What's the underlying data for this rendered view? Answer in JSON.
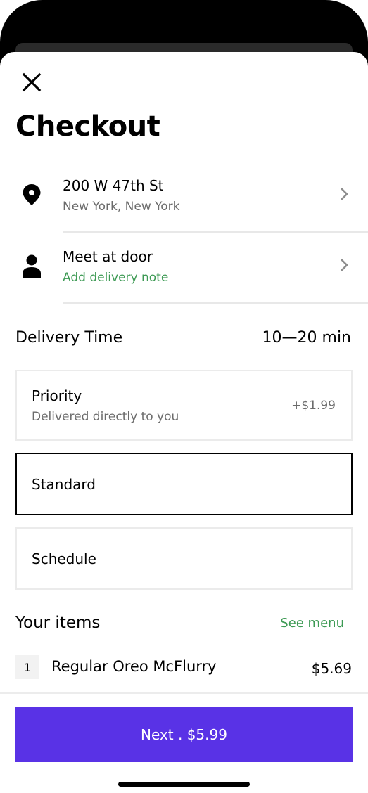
{
  "header": {
    "title": "Checkout"
  },
  "address": {
    "line1": "200 W 47th St",
    "line2": "New York, New York"
  },
  "dropoff": {
    "line1": "Meet at door",
    "line2": "Add delivery note"
  },
  "delivery": {
    "label": "Delivery Time",
    "eta": "10—20 min",
    "options": [
      {
        "name": "Priority",
        "subtitle": "Delivered directly to you",
        "price": "+$1.99",
        "selected": false
      },
      {
        "name": "Standard",
        "selected": true
      },
      {
        "name": "Schedule",
        "selected": false
      }
    ]
  },
  "items": {
    "label": "Your items",
    "see_menu": "See menu",
    "list": [
      {
        "qty": "1",
        "name": "Regular Oreo McFlurry",
        "price": "$5.69"
      }
    ]
  },
  "cta": {
    "label": "Next . $5.99"
  },
  "colors": {
    "accent": "#5932e6",
    "link_green": "#3d9a54",
    "secondary_text": "#6b6b6b"
  },
  "icons": {
    "close": "close-icon",
    "location": "location-pin-icon",
    "person": "person-icon",
    "chevron": "chevron-right-icon"
  }
}
